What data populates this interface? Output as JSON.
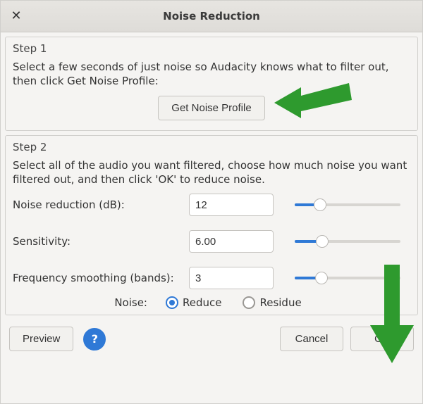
{
  "window": {
    "title": "Noise Reduction"
  },
  "step1": {
    "title": "Step 1",
    "desc": "Select a few seconds of just noise so Audacity knows what to filter out, then click Get Noise Profile:",
    "button": "Get Noise Profile"
  },
  "step2": {
    "title": "Step 2",
    "desc": "Select all of the audio you want filtered, choose how much noise you want filtered out, and then click 'OK' to reduce noise.",
    "params": {
      "noise_reduction": {
        "label": "Noise reduction (dB):",
        "value": "12",
        "pct": 24
      },
      "sensitivity": {
        "label": "Sensitivity:",
        "value": "6.00",
        "pct": 26
      },
      "freq_smoothing": {
        "label": "Frequency smoothing (bands):",
        "value": "3",
        "pct": 25
      }
    },
    "noise_label": "Noise:",
    "radio": {
      "reduce": "Reduce",
      "residue": "Residue",
      "selected": "reduce"
    }
  },
  "buttons": {
    "preview": "Preview",
    "help": "?",
    "cancel": "Cancel",
    "ok": "OK"
  },
  "colors": {
    "accent": "#2f79d6",
    "arrow": "#2e9a2e"
  }
}
